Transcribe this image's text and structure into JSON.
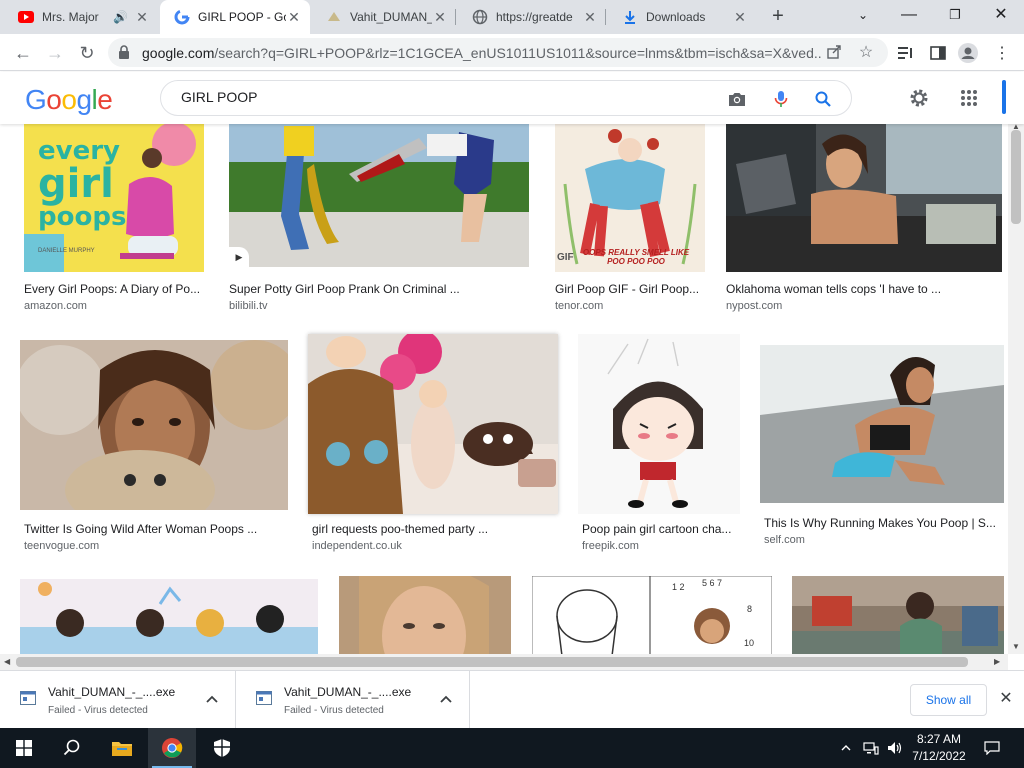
{
  "browser": {
    "tabs": [
      {
        "title": "Mrs. Major",
        "favicon": "youtube-icon",
        "audio": true
      },
      {
        "title": "GIRL POOP - Go",
        "favicon": "google-icon",
        "active": true
      },
      {
        "title": "Vahit_DUMAN_",
        "favicon": "vahit-icon"
      },
      {
        "title": "https://greatde",
        "favicon": "globe-icon"
      },
      {
        "title": "Downloads",
        "favicon": "download-icon"
      }
    ],
    "url_host": "google.com",
    "url_path": "/search?q=GIRL+POOP&rlz=1C1GCEA_enUS1011US1011&source=lnms&tbm=isch&sa=X&ved..."
  },
  "google": {
    "logo": "Google",
    "query": "GIRL POOP"
  },
  "results": [
    {
      "caption": "Every Girl Poops: A Diary of Po...",
      "source": "amazon.com"
    },
    {
      "caption": "Super Potty Girl Poop Prank On Criminal ...",
      "source": "bilibili.tv"
    },
    {
      "caption": "Girl Poop GIF - Girl Poop...",
      "source": "tenor.com",
      "badge": "GIF"
    },
    {
      "caption": "Oklahoma woman tells cops 'I have to ...",
      "source": "nypost.com"
    },
    {
      "caption": "Twitter Is Going Wild After Woman Poops ...",
      "source": "teenvogue.com"
    },
    {
      "caption": "girl requests poo-themed party ...",
      "source": "independent.co.uk"
    },
    {
      "caption": "Poop pain girl cartoon cha...",
      "source": "freepik.com"
    },
    {
      "caption": "This Is Why Running Makes You Poop | S...",
      "source": "self.com"
    },
    {
      "caption": "",
      "source": ""
    },
    {
      "caption": "",
      "source": ""
    },
    {
      "caption": "",
      "source": ""
    },
    {
      "caption": "",
      "source": ""
    }
  ],
  "book_cover": {
    "line1": "every",
    "line2": "girl",
    "line3": "poops",
    "author": "DANIELLE MURPHY"
  },
  "gif_overlay": "OOPS REALLY SMELL LIKE POO POO POO",
  "downloads": [
    {
      "filename": "Vahit_DUMAN_-_....exe",
      "status": "Failed - Virus detected"
    },
    {
      "filename": "Vahit_DUMAN_-_....exe",
      "status": "Failed - Virus detected"
    }
  ],
  "shelf": {
    "show_all": "Show all"
  },
  "taskbar": {
    "time": "8:27 AM",
    "date": "7/12/2022"
  },
  "colors": {
    "accent": "#1a73e8",
    "tabstrip": "#dee1e6",
    "taskbar": "#101820"
  }
}
